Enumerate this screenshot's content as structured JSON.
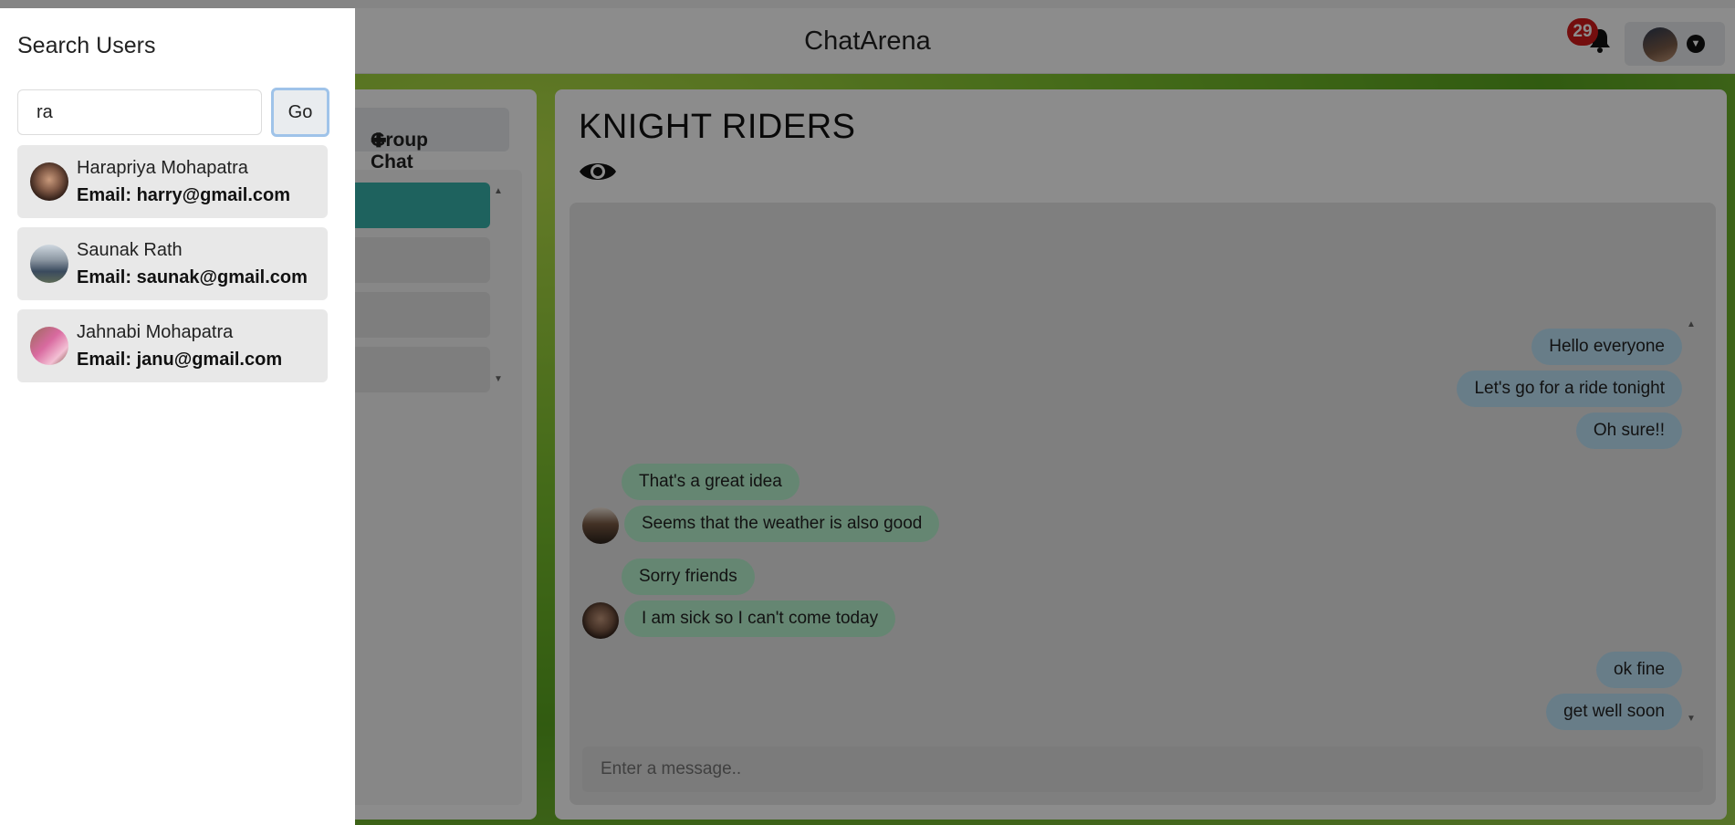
{
  "header": {
    "app_title": "ChatArena",
    "notification_count": "29"
  },
  "sidebar_panel": {
    "new_group_label": "Group Chat"
  },
  "chat": {
    "title": "KNIGHT RIDERS",
    "input_placeholder": "Enter a message..",
    "messages": [
      {
        "text": "Hello everyone",
        "side": "me"
      },
      {
        "text": "Let's go for a ride tonight",
        "side": "me"
      },
      {
        "text": "Oh sure!!",
        "side": "me"
      },
      {
        "text": "That's a great idea",
        "side": "other"
      },
      {
        "text": "Seems that the weather is also good",
        "side": "other"
      },
      {
        "text": "Sorry friends",
        "side": "other"
      },
      {
        "text": "I am sick so I can't come today",
        "side": "other"
      },
      {
        "text": "ok fine",
        "side": "me"
      },
      {
        "text": "get well soon",
        "side": "me"
      }
    ]
  },
  "search_drawer": {
    "title": "Search Users",
    "query": "ra",
    "go_label": "Go",
    "results": [
      {
        "name": "Harapriya Mohapatra",
        "email": "Email: harry@gmail.com"
      },
      {
        "name": "Saunak Rath",
        "email": "Email: saunak@gmail.com"
      },
      {
        "name": "Jahnabi Mohapatra",
        "email": "Email: janu@gmail.com"
      }
    ]
  }
}
